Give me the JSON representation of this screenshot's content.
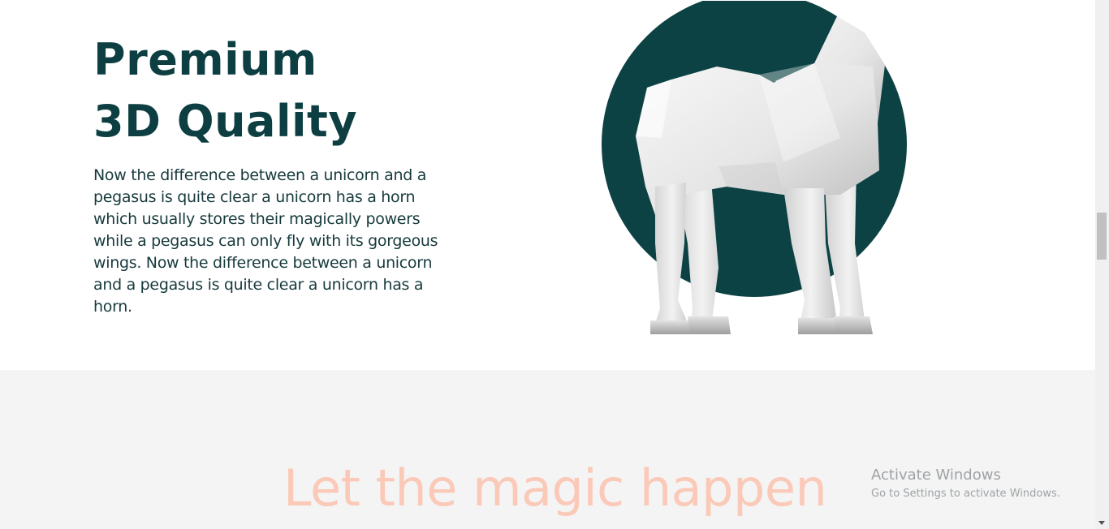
{
  "feature": {
    "heading_line1": "Premium",
    "heading_line2": "3D Quality",
    "body": "Now the difference between a unicorn and a pegasus is quite clear a unicorn has a horn which usually stores their magically powers while a pegasus can only fly with its gorgeous wings. Now the difference between a unicorn and a pegasus is quite clear a unicorn has a horn.",
    "accent_color": "#0d3f42",
    "image_icon": "white-3d-horse-icon"
  },
  "magic_section": {
    "title": "Let the magic happen",
    "title_color": "#fbc9b8",
    "background": "#f4f4f4"
  },
  "watermark": {
    "title": "Activate Windows",
    "subtitle": "Go to Settings to activate Windows."
  }
}
